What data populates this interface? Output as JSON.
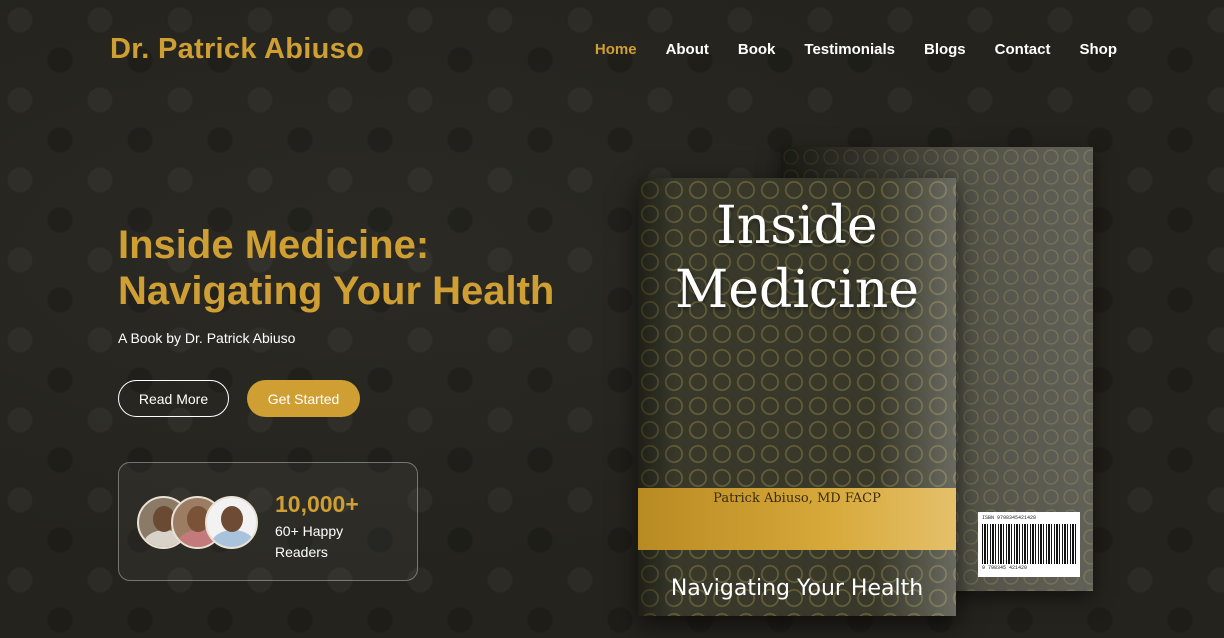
{
  "header": {
    "logo": "Dr. Patrick Abiuso",
    "nav": [
      {
        "label": "Home"
      },
      {
        "label": "About"
      },
      {
        "label": "Book"
      },
      {
        "label": "Testimonials"
      },
      {
        "label": "Blogs"
      },
      {
        "label": "Contact"
      },
      {
        "label": "Shop"
      }
    ],
    "active_item": "Home"
  },
  "hero": {
    "title_line1": "Inside Medicine:",
    "title_line2": "Navigating Your Health",
    "subtitle": "A Book by Dr. Patrick Abiuso",
    "read_more_label": "Read More",
    "get_started_label": "Get Started"
  },
  "stats": {
    "number": "10,000+",
    "label": "60+ Happy Readers"
  },
  "book": {
    "title_line1": "Inside",
    "title_line2": "Medicine",
    "author": "Patrick Abiuso, MD FACP",
    "subtitle": "Navigating Your Health",
    "isbn": "ISBN 9798345421420",
    "barcode_number": "9 798345 421420",
    "price_code": "90000"
  },
  "colors": {
    "accent": "#cf9f33",
    "background": "#24231d",
    "text": "#ffffff"
  }
}
